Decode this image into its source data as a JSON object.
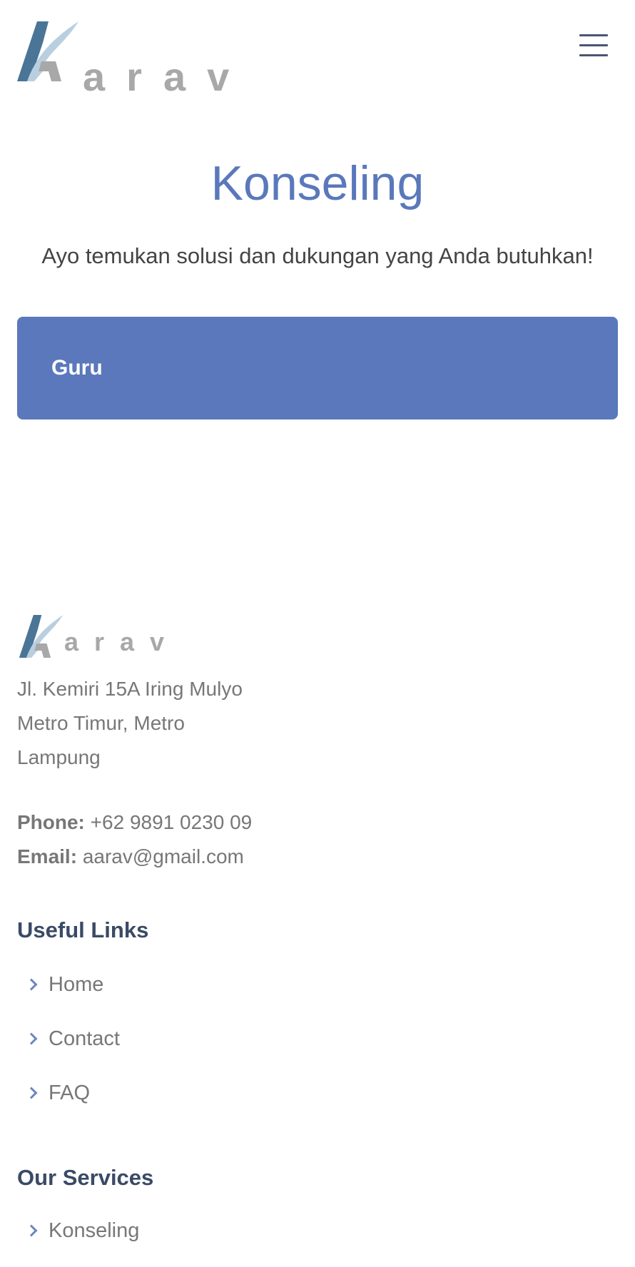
{
  "header": {
    "logo_text": "arav",
    "menu_icon": "hamburger-menu-icon"
  },
  "hero": {
    "title": "Konseling",
    "subtitle": "Ayo temukan solusi dan dukungan yang Anda butuhkan!",
    "card_label": "Guru"
  },
  "footer": {
    "logo_text": "arav",
    "address": [
      "Jl. Kemiri 15A Iring Mulyo",
      "Metro Timur, Metro",
      "Lampung"
    ],
    "phone_label": "Phone:",
    "phone": "+62 9891 0230 09",
    "email_label": "Email:",
    "email": "aarav@gmail.com",
    "useful_links_title": "Useful Links",
    "useful_links": [
      "Home",
      "Contact",
      "FAQ"
    ],
    "services_title": "Our Services",
    "services": [
      "Konseling"
    ]
  },
  "colors": {
    "accent": "#5a78bb",
    "heading": "#3a4a66",
    "text": "#777777",
    "logo_gray": "#a8a8a8"
  }
}
